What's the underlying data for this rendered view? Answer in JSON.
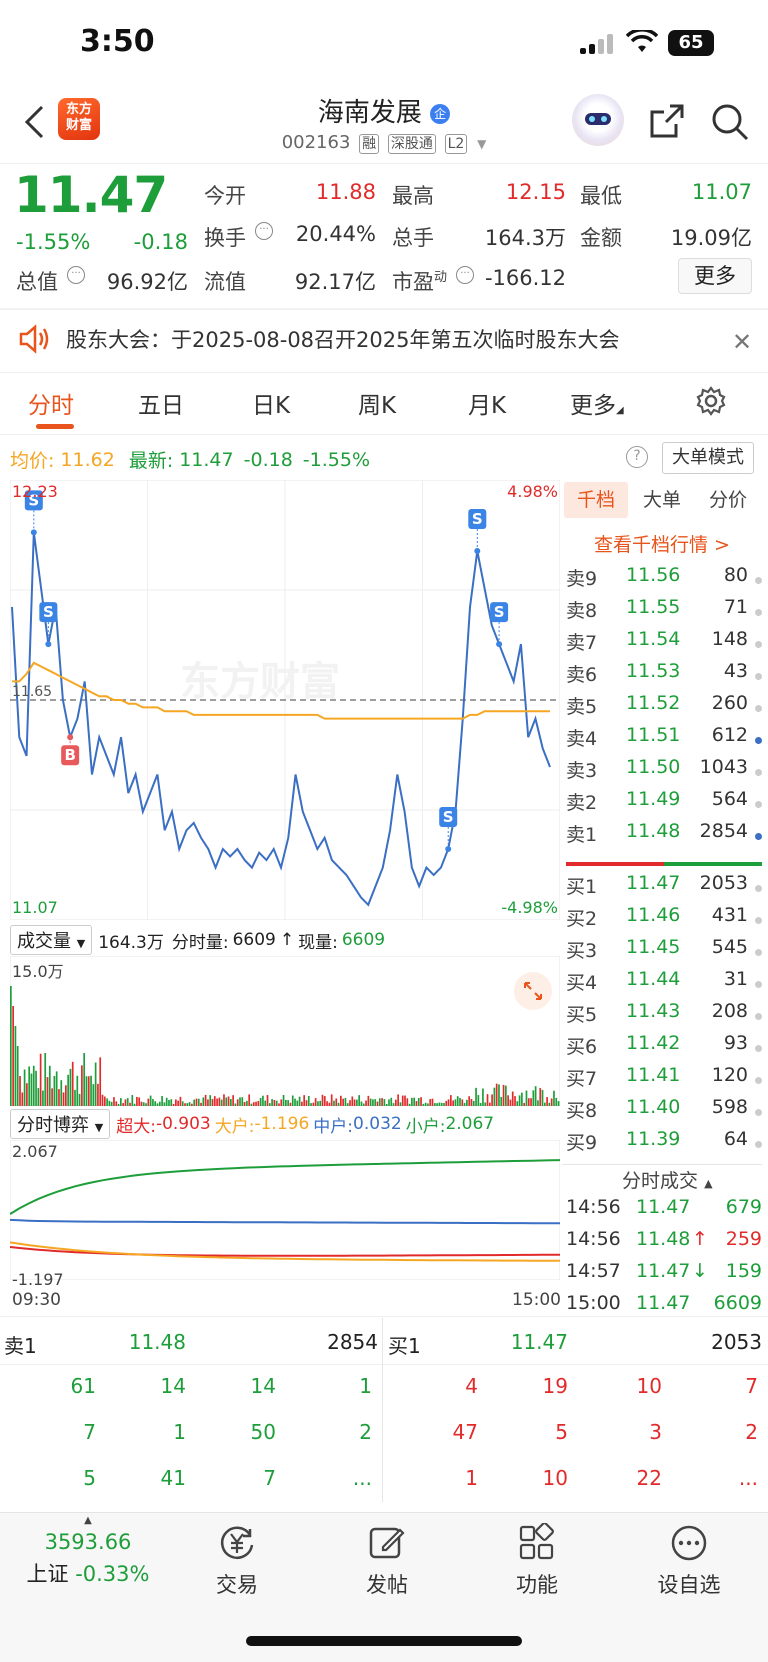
{
  "status_bar": {
    "time": "3:50",
    "battery": "65"
  },
  "header": {
    "logo_line1": "东方",
    "logo_line2": "财富",
    "stock_name": "海南发展",
    "corp_badge": "企",
    "stock_code": "002163",
    "tags": [
      "融",
      "深股通",
      "L2"
    ]
  },
  "quote": {
    "price": "11.47",
    "change_pct": "-1.55%",
    "change": "-0.18",
    "cap_label": "总值",
    "cap_value": "96.92亿",
    "float_label": "流值",
    "float_value": "92.17亿",
    "open_label": "今开",
    "open_value": "11.88",
    "high_label": "最高",
    "high_value": "12.15",
    "low_label": "最低",
    "low_value": "11.07",
    "turnover_label": "换手",
    "turnover_value": "20.44%",
    "volume_label": "总手",
    "volume_value": "164.3万",
    "amount_label": "金额",
    "amount_value": "19.09亿",
    "pe_label": "市盈",
    "pe_sup": "动",
    "pe_value": "-166.12",
    "more_label": "更多"
  },
  "notice": {
    "text": "股东大会：于2025-08-08召开2025年第五次临时股东大会"
  },
  "tabs": [
    {
      "label": "分时"
    },
    {
      "label": "五日"
    },
    {
      "label": "日K"
    },
    {
      "label": "周K"
    },
    {
      "label": "月K"
    },
    {
      "label": "更多"
    }
  ],
  "info_line": {
    "avg_label": "均价:",
    "avg_value": "11.62",
    "latest_label": "最新:",
    "latest_value": "11.47",
    "latest_change": "-0.18",
    "latest_pct": "-1.55%",
    "bigorder_label": "大单模式"
  },
  "chart_axis": {
    "top_price": "12.23",
    "top_pct": "4.98%",
    "bottom_price": "11.07",
    "bottom_pct": "-4.98%",
    "ref_price": "11.65",
    "watermark": "东方财富"
  },
  "chart_data": {
    "type": "line",
    "title": "",
    "xlabel": "",
    "ylabel": "",
    "ylim": [
      11.07,
      12.23
    ],
    "reference": 11.65,
    "series": [
      {
        "name": "",
        "color": "#3a6fc4",
        "values": [
          11.9,
          11.55,
          11.5,
          12.1,
          11.95,
          11.8,
          11.9,
          11.65,
          11.55,
          11.6,
          11.7,
          11.45,
          11.55,
          11.5,
          11.45,
          11.55,
          11.4,
          11.45,
          11.35,
          11.4,
          11.45,
          11.3,
          11.35,
          11.25,
          11.3,
          11.32,
          11.28,
          11.25,
          11.2,
          11.25,
          11.23,
          11.25,
          11.22,
          11.2,
          11.24,
          11.22,
          11.25,
          11.2,
          11.28,
          11.45,
          11.35,
          11.3,
          11.25,
          11.28,
          11.22,
          11.2,
          11.18,
          11.15,
          11.12,
          11.1,
          11.15,
          11.2,
          11.3,
          11.45,
          11.35,
          11.2,
          11.15,
          11.2,
          11.18,
          11.2,
          11.25,
          11.35,
          11.6,
          11.9,
          12.05,
          11.95,
          11.85,
          11.8,
          11.75,
          11.7,
          11.8,
          11.55,
          11.6,
          11.52,
          11.47
        ]
      },
      {
        "name": "",
        "color": "#f5a623",
        "values": [
          11.7,
          11.7,
          11.72,
          11.75,
          11.74,
          11.73,
          11.72,
          11.71,
          11.7,
          11.69,
          11.68,
          11.67,
          11.66,
          11.66,
          11.65,
          11.65,
          11.64,
          11.64,
          11.63,
          11.63,
          11.63,
          11.62,
          11.62,
          11.62,
          11.62,
          11.61,
          11.61,
          11.61,
          11.61,
          11.61,
          11.61,
          11.61,
          11.61,
          11.61,
          11.61,
          11.61,
          11.61,
          11.61,
          11.61,
          11.61,
          11.61,
          11.61,
          11.61,
          11.6,
          11.6,
          11.6,
          11.6,
          11.6,
          11.6,
          11.6,
          11.6,
          11.6,
          11.6,
          11.6,
          11.6,
          11.6,
          11.6,
          11.6,
          11.6,
          11.6,
          11.6,
          11.6,
          11.6,
          11.61,
          11.61,
          11.62,
          11.62,
          11.62,
          11.62,
          11.62,
          11.62,
          11.62,
          11.62,
          11.62,
          11.62
        ]
      }
    ]
  },
  "volume": {
    "selector_label": "成交量",
    "total": "164.3万",
    "minute_label": "分时量:",
    "minute_value": "6609",
    "now_label": "现量:",
    "now_value": "6609",
    "axis_max": "15.0万"
  },
  "game": {
    "selector_label": "分时博弈",
    "xl_label": "超大:",
    "xl_value": "-0.903",
    "l_label": "大户:",
    "l_value": "-1.196",
    "m_label": "中户:",
    "m_value": "0.032",
    "s_label": "小户:",
    "s_value": "2.067",
    "axis_top": "2.067",
    "axis_bottom": "-1.197",
    "time_start": "09:30",
    "time_end": "15:00"
  },
  "order_book": {
    "tabs": [
      "千档",
      "大单",
      "分价"
    ],
    "link": "查看千档行情 >",
    "asks": [
      {
        "label": "卖9",
        "price": "11.56",
        "vol": "80"
      },
      {
        "label": "卖8",
        "price": "11.55",
        "vol": "71"
      },
      {
        "label": "卖7",
        "price": "11.54",
        "vol": "148"
      },
      {
        "label": "卖6",
        "price": "11.53",
        "vol": "43"
      },
      {
        "label": "卖5",
        "price": "11.52",
        "vol": "260"
      },
      {
        "label": "卖4",
        "price": "11.51",
        "vol": "612"
      },
      {
        "label": "卖3",
        "price": "11.50",
        "vol": "1043"
      },
      {
        "label": "卖2",
        "price": "11.49",
        "vol": "564"
      },
      {
        "label": "卖1",
        "price": "11.48",
        "vol": "2854"
      }
    ],
    "bids": [
      {
        "label": "买1",
        "price": "11.47",
        "vol": "2053"
      },
      {
        "label": "买2",
        "price": "11.46",
        "vol": "431"
      },
      {
        "label": "买3",
        "price": "11.45",
        "vol": "545"
      },
      {
        "label": "买4",
        "price": "11.44",
        "vol": "31"
      },
      {
        "label": "买5",
        "price": "11.43",
        "vol": "208"
      },
      {
        "label": "买6",
        "price": "11.42",
        "vol": "93"
      },
      {
        "label": "买7",
        "price": "11.41",
        "vol": "120"
      },
      {
        "label": "买8",
        "price": "11.40",
        "vol": "598"
      },
      {
        "label": "买9",
        "price": "11.39",
        "vol": "64"
      }
    ],
    "trades_title": "分时成交",
    "trades": [
      {
        "time": "14:56",
        "price": "11.47",
        "vol": "679",
        "arrow": ""
      },
      {
        "time": "14:56",
        "price": "11.48",
        "vol": "259",
        "arrow": "↑"
      },
      {
        "time": "14:57",
        "price": "11.47",
        "vol": "159",
        "arrow": "↓"
      },
      {
        "time": "15:00",
        "price": "11.47",
        "vol": "6609",
        "arrow": ""
      }
    ]
  },
  "depth": {
    "sell_label": "卖1",
    "sell_price": "11.48",
    "sell_vol": "2854",
    "buy_label": "买1",
    "buy_price": "11.47",
    "buy_vol": "2053",
    "sell_rows": [
      [
        "61",
        "14",
        "14",
        "1"
      ],
      [
        "7",
        "1",
        "50",
        "2"
      ],
      [
        "5",
        "41",
        "7",
        "..."
      ]
    ],
    "buy_rows": [
      [
        "4",
        "19",
        "10",
        "7"
      ],
      [
        "47",
        "5",
        "3",
        "2"
      ],
      [
        "1",
        "10",
        "22",
        "..."
      ]
    ]
  },
  "bottom_nav": {
    "index_value": "3593.66",
    "index_name": "上证",
    "index_change": "-0.33%",
    "items": [
      {
        "label": "交易"
      },
      {
        "label": "发帖"
      },
      {
        "label": "功能"
      },
      {
        "label": "设自选"
      }
    ]
  }
}
